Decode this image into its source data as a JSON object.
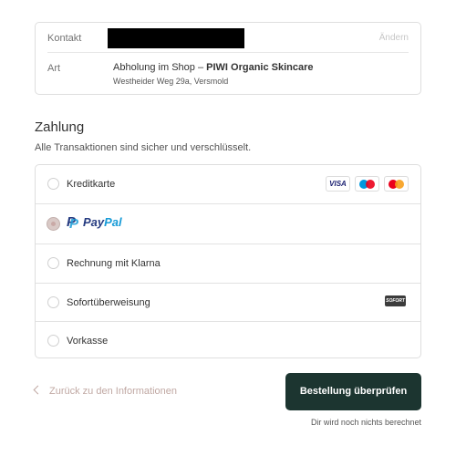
{
  "summary": {
    "contact_label": "Kontakt",
    "change_link": "Ändern",
    "type_label": "Art",
    "shipping_prefix": "Abholung im Shop – ",
    "shipping_store": "PIWI Organic Skincare",
    "shipping_address": "Westheider Weg 29a, Versmold"
  },
  "payment": {
    "title": "Zahlung",
    "subtitle": "Alle Transaktionen sind sicher und verschlüsselt.",
    "selected": "PayPal",
    "methods": [
      {
        "label": "Kreditkarte",
        "icons": [
          "visa-icon",
          "maestro-icon",
          "mastercard-icon"
        ]
      },
      {
        "label": "PayPal",
        "icons": [
          "paypal-logo"
        ]
      },
      {
        "label": "Rechnung mit Klarna"
      },
      {
        "label": "Sofortüberweisung",
        "icons": [
          "sofort-icon"
        ]
      },
      {
        "label": "Vorkasse"
      }
    ],
    "visa_text": "VISA",
    "paypal_pay": "Pay",
    "paypal_pal": "Pal",
    "sofort_text": "SOFORT"
  },
  "footer": {
    "back_label": "Zurück zu den Informationen",
    "submit_label": "Bestellung überprüfen",
    "note": "Dir wird noch nichts berechnet"
  },
  "colors": {
    "primary_button": "#1c3530",
    "accent": "#c0a8a3",
    "visa": "#1a1f71",
    "paypal_dark": "#253b80",
    "paypal_light": "#179bd7",
    "mastercard_red": "#eb001b",
    "mastercard_yellow": "#f79e1b",
    "maestro_blue": "#0099df"
  }
}
